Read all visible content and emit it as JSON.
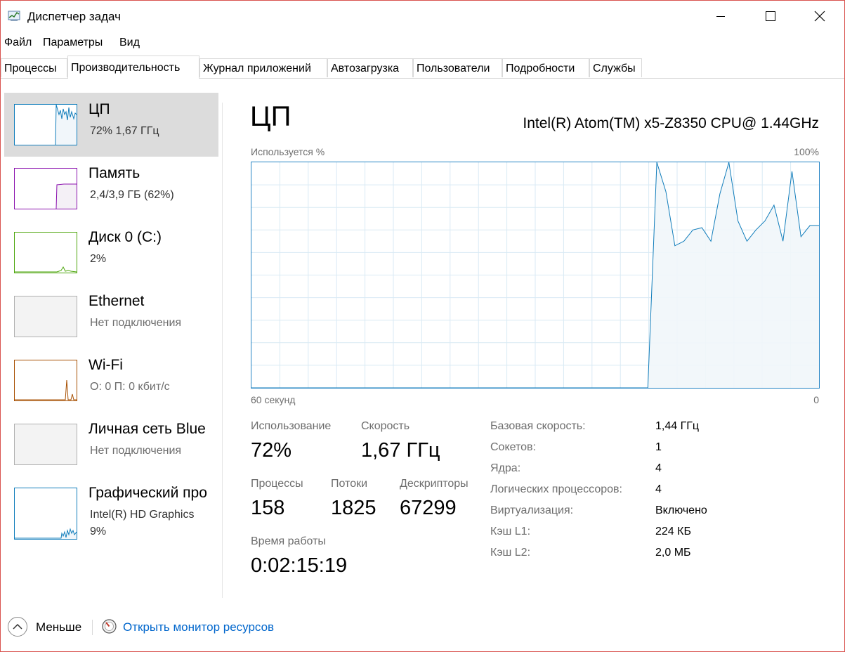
{
  "window": {
    "title": "Диспетчер задач",
    "icons": {
      "app": "task-manager-icon",
      "minimize": "minimize-icon",
      "maximize": "maximize-icon",
      "close": "close-icon"
    }
  },
  "menu": [
    "Файл",
    "Параметры",
    "Вид"
  ],
  "tabs": [
    "Процессы",
    "Производительность",
    "Журнал приложений",
    "Автозагрузка",
    "Пользователи",
    "Подробности",
    "Службы"
  ],
  "active_tab": "Производительность",
  "sidebar": {
    "items": [
      {
        "title": "ЦП",
        "sub": "72%  1,67 ГГц",
        "color": "#117dbb",
        "selected": true
      },
      {
        "title": "Память",
        "sub": "2,4/3,9 ГБ (62%)",
        "color": "#8b12ae"
      },
      {
        "title": "Диск 0 (C:)",
        "sub": "2%",
        "color": "#4da60c"
      },
      {
        "title": "Ethernet",
        "sub": "Нет подключения",
        "color": "#b0b0b0"
      },
      {
        "title": "Wi-Fi",
        "sub": "О: 0  П: 0 кбит/с",
        "color": "#a74f01"
      },
      {
        "title": "Личная сеть Blue",
        "sub": "Нет подключения",
        "color": "#b0b0b0"
      },
      {
        "title": "Графический про",
        "sub": "Intel(R) HD Graphics",
        "sub2": "9%",
        "color": "#117dbb"
      }
    ]
  },
  "main": {
    "title": "ЦП",
    "cpu_name": "Intel(R) Atom(TM) x5-Z8350 CPU@ 1.44GHz",
    "graph_label": "Используется %",
    "graph_max": "100%",
    "graph_time": "60 секунд",
    "graph_min": "0",
    "stats": {
      "usage_label": "Использование",
      "usage_value": "72%",
      "speed_label": "Скорость",
      "speed_value": "1,67 ГГц",
      "processes_label": "Процессы",
      "processes_value": "158",
      "threads_label": "Потоки",
      "threads_value": "1825",
      "handles_label": "Дескрипторы",
      "handles_value": "67299",
      "uptime_label": "Время работы",
      "uptime_value": "0:02:15:19"
    },
    "info": [
      {
        "label": "Базовая скорость:",
        "value": "1,44 ГГц"
      },
      {
        "label": "Сокетов:",
        "value": "1"
      },
      {
        "label": "Ядра:",
        "value": "4"
      },
      {
        "label": "Логических процессоров:",
        "value": "4"
      },
      {
        "label": "Виртуализация:",
        "value": "Включено"
      },
      {
        "label": "Кэш L1:",
        "value": "224 КБ"
      },
      {
        "label": "Кэш L2:",
        "value": "2,0 МБ"
      }
    ]
  },
  "footer": {
    "less_label": "Меньше",
    "monitor_link": "Открыть монитор ресурсов",
    "icons": {
      "less": "chevron-up-icon",
      "monitor": "resource-monitor-icon"
    }
  },
  "chart_data": {
    "type": "area",
    "title": "ЦП",
    "ylabel": "Используется %",
    "xlabel": "60 секунд",
    "ylim": [
      0,
      100
    ],
    "x": [
      0,
      1,
      2,
      3,
      4,
      5,
      6,
      7,
      8,
      9,
      10,
      11,
      12,
      13,
      14,
      15,
      16,
      17,
      18,
      19,
      20,
      21,
      22,
      23,
      24,
      25,
      26,
      27,
      28,
      29,
      30,
      31,
      32,
      33,
      34,
      35,
      36,
      37,
      38,
      39,
      40,
      41,
      42,
      43,
      44,
      45,
      46,
      47,
      48,
      49,
      50,
      51,
      52,
      53,
      54,
      55,
      56,
      57,
      58,
      59,
      60
    ],
    "values": [
      0,
      0,
      0,
      0,
      0,
      0,
      0,
      0,
      0,
      0,
      0,
      0,
      0,
      0,
      0,
      0,
      0,
      0,
      0,
      0,
      0,
      0,
      0,
      0,
      0,
      0,
      0,
      0,
      0,
      0,
      0,
      0,
      0,
      0,
      0,
      0,
      0,
      0,
      0,
      0,
      0,
      0,
      0,
      0,
      0,
      100,
      87,
      63,
      65,
      70,
      71,
      65,
      86,
      100,
      74,
      65,
      70,
      74,
      81,
      65,
      96,
      67,
      72,
      72
    ],
    "grid": true,
    "color": "#117dbb"
  }
}
